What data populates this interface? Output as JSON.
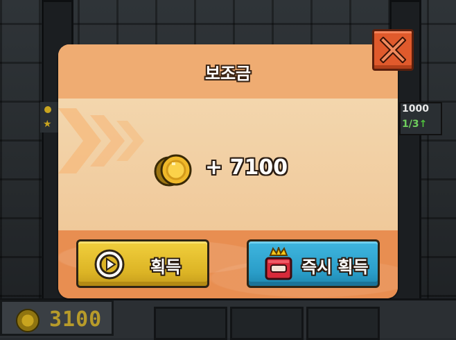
{
  "dialog": {
    "title": "보조금",
    "reward_amount": "+ 7100",
    "claim_label": "획득",
    "instant_claim_label": "즉시 획득"
  },
  "hud": {
    "coins": "3100",
    "right_value": "1000",
    "right_progress": "1/3"
  },
  "colors": {
    "panel": "#e9a36a",
    "panel_body": "#f3d6ad",
    "claim_button": "#dcb425",
    "instant_button": "#2a9dc8",
    "close_button": "#e05a2c"
  },
  "icons": [
    "close-icon",
    "coin-icon",
    "play-icon",
    "shop-icon",
    "up-arrow-icon"
  ]
}
